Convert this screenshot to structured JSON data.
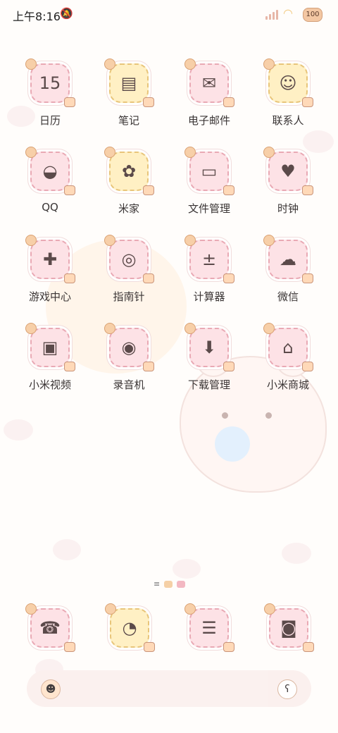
{
  "status_bar": {
    "time": "上午8:16",
    "battery": "100"
  },
  "apps": [
    {
      "label": "日历",
      "icon": "calendar-icon",
      "glyph": "15",
      "tone": "pink"
    },
    {
      "label": "笔记",
      "icon": "notes-icon",
      "glyph": "▤",
      "tone": "yellow"
    },
    {
      "label": "电子邮件",
      "icon": "mail-icon",
      "glyph": "✉",
      "tone": "pink"
    },
    {
      "label": "联系人",
      "icon": "contacts-icon",
      "glyph": "☺",
      "tone": "yellow"
    },
    {
      "label": "QQ",
      "icon": "qq-penguin-icon",
      "glyph": "◒",
      "tone": "pink"
    },
    {
      "label": "米家",
      "icon": "mijia-flower-icon",
      "glyph": "✿",
      "tone": "yellow"
    },
    {
      "label": "文件管理",
      "icon": "file-manager-icon",
      "glyph": "▭",
      "tone": "pink"
    },
    {
      "label": "时钟",
      "icon": "clock-icon",
      "glyph": "♥",
      "tone": "pink"
    },
    {
      "label": "游戏中心",
      "icon": "gamepad-icon",
      "glyph": "✚",
      "tone": "pink"
    },
    {
      "label": "指南针",
      "icon": "compass-icon",
      "glyph": "◎",
      "tone": "pink"
    },
    {
      "label": "计算器",
      "icon": "calculator-icon",
      "glyph": "±",
      "tone": "pink"
    },
    {
      "label": "微信",
      "icon": "wechat-icon",
      "glyph": "☁",
      "tone": "pink"
    },
    {
      "label": "小米视频",
      "icon": "video-tv-icon",
      "glyph": "▣",
      "tone": "pink"
    },
    {
      "label": "录音机",
      "icon": "recorder-icon",
      "glyph": "◉",
      "tone": "pink"
    },
    {
      "label": "下载管理",
      "icon": "download-icon",
      "glyph": "⬇",
      "tone": "pink"
    },
    {
      "label": "小米商城",
      "icon": "shop-bag-icon",
      "glyph": "⌂",
      "tone": "pink"
    }
  ],
  "dock": [
    {
      "icon": "phone-icon",
      "glyph": "☎",
      "tone": "pink"
    },
    {
      "icon": "messages-icon",
      "glyph": "◔",
      "tone": "yellow"
    },
    {
      "icon": "chat-bubble-icon",
      "glyph": "☰",
      "tone": "pink"
    },
    {
      "icon": "camera-icon",
      "glyph": "◙",
      "tone": "pink"
    }
  ],
  "colors": {
    "tile_pink": "#fde2e6",
    "tile_yellow": "#fff0c4",
    "dash_border": "#e9a9b4"
  }
}
